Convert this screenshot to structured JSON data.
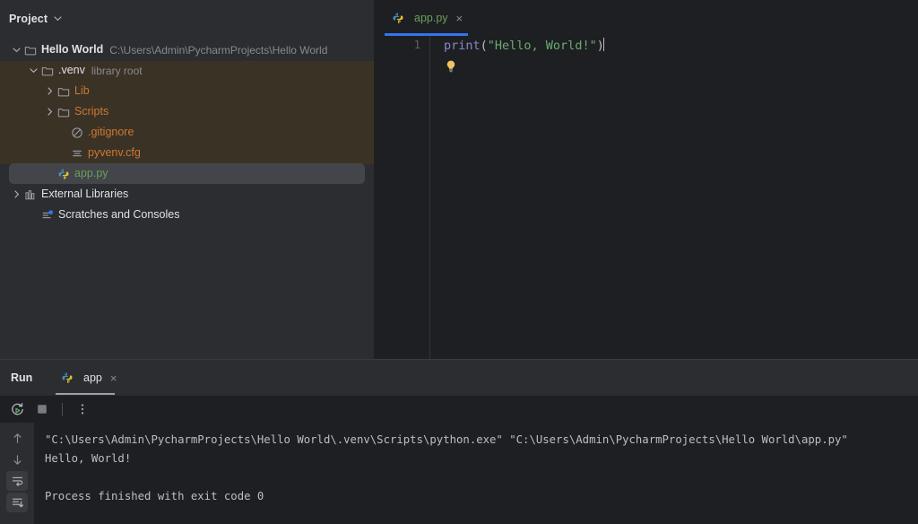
{
  "sidebar": {
    "title": "Project",
    "chevron_icon": "chevron-down-icon",
    "tree": [
      {
        "label": "Hello World",
        "sub": "C:\\Users\\Admin\\PycharmProjects\\Hello World",
        "icon": "folder-icon",
        "twisty": "chevron-down-icon",
        "indent": 0,
        "style": "bold-white",
        "selected": false
      },
      {
        "label": ".venv",
        "sub": "library root",
        "icon": "folder-icon",
        "twisty": "chevron-down-icon",
        "indent": 1,
        "style": "white",
        "selected": false
      },
      {
        "label": "Lib",
        "sub": "",
        "icon": "folder-icon",
        "twisty": "chevron-right-icon",
        "indent": 2,
        "style": "orange",
        "selected": false
      },
      {
        "label": "Scripts",
        "sub": "",
        "icon": "folder-icon",
        "twisty": "chevron-right-icon",
        "indent": 2,
        "style": "orange",
        "selected": false
      },
      {
        "label": ".gitignore",
        "sub": "",
        "icon": "gitignore-icon",
        "twisty": "none",
        "indent": 2,
        "style": "orange",
        "selected": false
      },
      {
        "label": "pyvenv.cfg",
        "sub": "",
        "icon": "config-file-icon",
        "twisty": "none",
        "indent": 2,
        "style": "orange",
        "selected": false
      },
      {
        "label": "app.py",
        "sub": "",
        "icon": "python-file-icon",
        "twisty": "none",
        "indent": 1,
        "style": "green",
        "selected": true
      },
      {
        "label": "External Libraries",
        "sub": "",
        "icon": "library-icon",
        "twisty": "chevron-right-icon",
        "indent": 0,
        "style": "white",
        "selected": false
      },
      {
        "label": "Scratches and Consoles",
        "sub": "",
        "icon": "scratches-icon",
        "twisty": "none",
        "indent": 0,
        "style": "white",
        "selected": false
      }
    ]
  },
  "editor": {
    "tab": {
      "label": "app.py",
      "icon": "python-file-icon",
      "close_icon": "close-icon",
      "close_glyph": "×",
      "active_underline_color": "#3573f0"
    },
    "line_number": "1",
    "code": {
      "function_name": "print",
      "open_paren": "(",
      "string": "\"Hello, World!\"",
      "close_paren": ")"
    },
    "intention_icon": "lightbulb-icon"
  },
  "run_panel": {
    "title": "Run",
    "tab": {
      "label": "app",
      "icon": "python-file-icon",
      "close_icon": "close-icon",
      "close_glyph": "×"
    },
    "toolbar": [
      {
        "name": "rerun-button",
        "icon": "rerun-icon"
      },
      {
        "name": "stop-button",
        "icon": "stop-icon"
      },
      {
        "name": "more-options-button",
        "icon": "vertical-dots-icon"
      }
    ],
    "console_gutter": [
      {
        "name": "scroll-up-button",
        "icon": "arrow-up-icon",
        "active": false
      },
      {
        "name": "scroll-down-button",
        "icon": "arrow-down-icon",
        "active": false
      },
      {
        "name": "soft-wrap-toggle",
        "icon": "soft-wrap-icon",
        "active": true
      },
      {
        "name": "scroll-to-end-toggle",
        "icon": "scroll-to-end-icon",
        "active": true
      }
    ],
    "console_lines": [
      "\"C:\\Users\\Admin\\PycharmProjects\\Hello World\\.venv\\Scripts\\python.exe\" \"C:\\Users\\Admin\\PycharmProjects\\Hello World\\app.py\"",
      "Hello, World!",
      "",
      "Process finished with exit code 0"
    ]
  },
  "colors": {
    "background": "#1e1f22",
    "panel": "#2b2d30",
    "excluded_band": "#3b3226",
    "selection": "#43454a",
    "accent_blue": "#3573f0",
    "text": "#dfe1e5",
    "muted": "#868a91",
    "orange": "#cc7832",
    "green": "#6a9f5b",
    "string_green": "#6aab73",
    "keyword_violet": "#8888c6"
  }
}
